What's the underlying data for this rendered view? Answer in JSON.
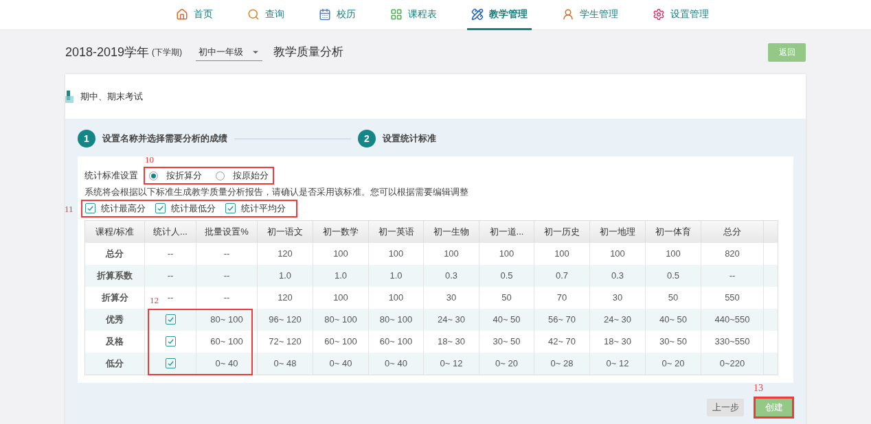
{
  "nav": [
    {
      "label": "首页",
      "selected": false
    },
    {
      "label": "查询",
      "selected": false
    },
    {
      "label": "校历",
      "selected": false
    },
    {
      "label": "课程表",
      "selected": false
    },
    {
      "label": "教学管理",
      "selected": true
    },
    {
      "label": "学生管理",
      "selected": false
    },
    {
      "label": "设置管理",
      "selected": false
    }
  ],
  "header": {
    "year": "2018-2019学年",
    "term": "(下学期)",
    "grade": "初中一年级",
    "title": "教学质量分析",
    "back_button": "返回"
  },
  "section_title": "期中、期末考试",
  "steps": [
    {
      "number": "1",
      "label": "设置名称并选择需要分析的成绩"
    },
    {
      "number": "2",
      "label": "设置统计标准"
    }
  ],
  "standard": {
    "label": "统计标准设置",
    "annotation": "10",
    "options": [
      {
        "label": "按折算分",
        "selected": true
      },
      {
        "label": "按原始分",
        "selected": false
      }
    ]
  },
  "notice": "系统将会根据以下标准生成教学质量分析报告，请确认是否采用该标准。您可以根据需要编辑调整",
  "stats": {
    "annotation": "11",
    "items": [
      {
        "label": "统计最高分",
        "checked": true
      },
      {
        "label": "统计最低分",
        "checked": true
      },
      {
        "label": "统计平均分",
        "checked": true
      }
    ]
  },
  "table": {
    "annotation": "12",
    "columns": [
      "课程/标准",
      "统计人...",
      "批量设置%",
      "初一语文",
      "初一数学",
      "初一英语",
      "初一生物",
      "初一道...",
      "初一历史",
      "初一地理",
      "初一体育",
      "总分"
    ],
    "rows": [
      {
        "kind": "text",
        "label": "总分",
        "cells": [
          "--",
          "--",
          "120",
          "100",
          "100",
          "100",
          "100",
          "100",
          "100",
          "100",
          "820"
        ]
      },
      {
        "kind": "text",
        "label": "折算系数",
        "cells": [
          "--",
          "--",
          "1.0",
          "1.0",
          "1.0",
          "0.3",
          "0.5",
          "0.7",
          "0.3",
          "0.5",
          "--"
        ]
      },
      {
        "kind": "text",
        "label": "折算分",
        "cells": [
          "--",
          "--",
          "120",
          "100",
          "100",
          "30",
          "50",
          "70",
          "30",
          "50",
          "550"
        ]
      },
      {
        "kind": "checkbox",
        "label": "优秀",
        "checked": true,
        "cells": [
          "80~ 100",
          "96~ 120",
          "80~ 100",
          "80~ 100",
          "24~ 30",
          "40~ 50",
          "56~ 70",
          "24~ 30",
          "40~ 50",
          "440~550"
        ]
      },
      {
        "kind": "checkbox",
        "label": "及格",
        "checked": true,
        "cells": [
          "60~ 100",
          "72~ 120",
          "60~ 100",
          "60~ 100",
          "18~ 30",
          "30~ 50",
          "42~ 70",
          "18~ 30",
          "30~ 50",
          "330~550"
        ]
      },
      {
        "kind": "checkbox",
        "label": "低分",
        "checked": true,
        "cells": [
          "0~ 40",
          "0~ 48",
          "0~ 40",
          "0~ 40",
          "0~ 12",
          "0~ 20",
          "0~ 28",
          "0~ 12",
          "0~ 20",
          "0~220"
        ]
      }
    ]
  },
  "footer": {
    "prev_button": "上一步",
    "create_button": "创建",
    "create_annotation": "13"
  }
}
